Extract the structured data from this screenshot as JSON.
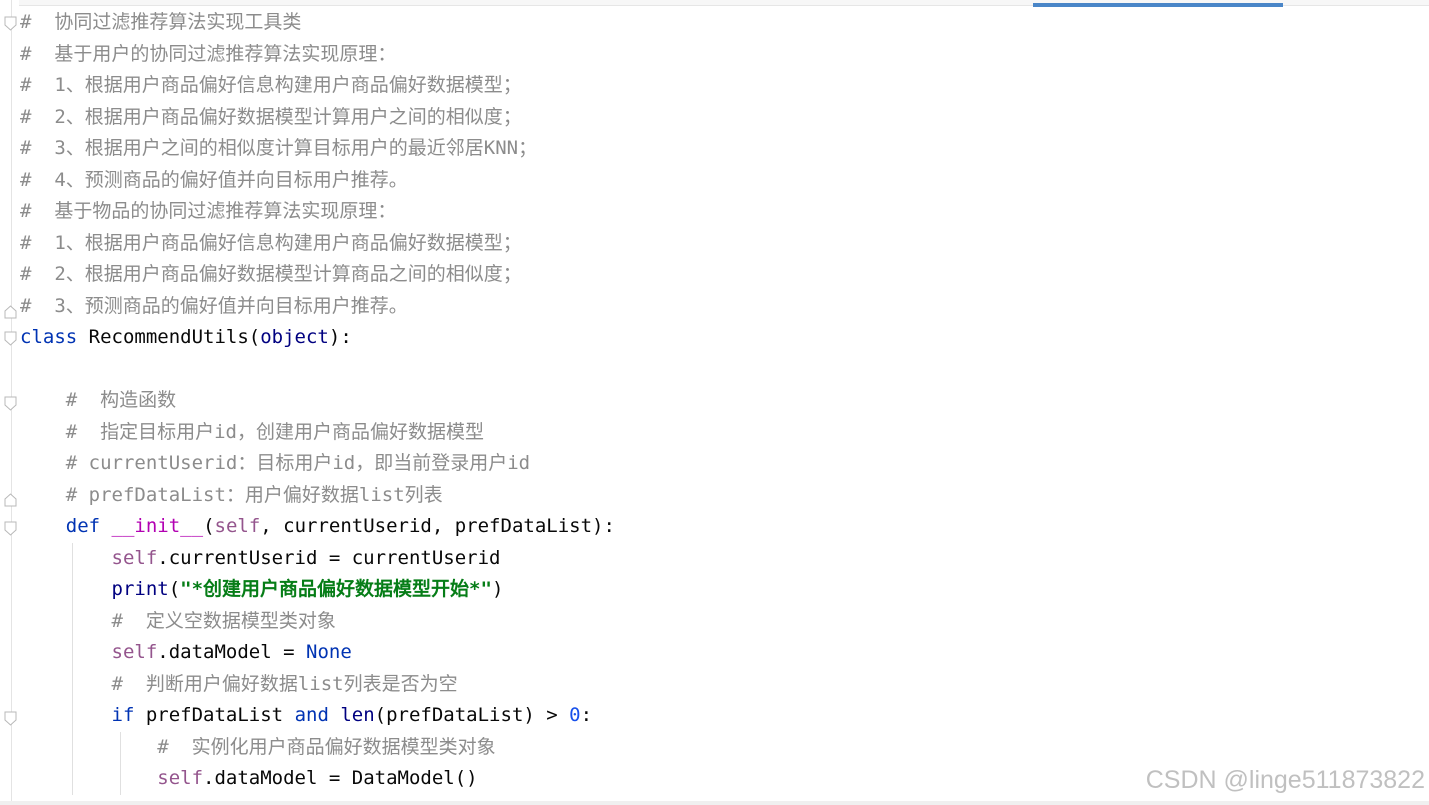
{
  "editor": {
    "lines": [
      {
        "parts": [
          {
            "t": "#  协同过滤推荐算法实现工具类",
            "c": "cm"
          }
        ]
      },
      {
        "parts": [
          {
            "t": "#  基于用户的协同过滤推荐算法实现原理：",
            "c": "cm"
          }
        ]
      },
      {
        "parts": [
          {
            "t": "#  1、根据用户商品偏好信息构建用户商品偏好数据模型；",
            "c": "cm"
          }
        ]
      },
      {
        "parts": [
          {
            "t": "#  2、根据用户商品偏好数据模型计算用户之间的相似度；",
            "c": "cm"
          }
        ]
      },
      {
        "parts": [
          {
            "t": "#  3、根据用户之间的相似度计算目标用户的最近邻居KNN；",
            "c": "cm"
          }
        ]
      },
      {
        "parts": [
          {
            "t": "#  4、预测商品的偏好值并向目标用户推荐。",
            "c": "cm"
          }
        ]
      },
      {
        "parts": [
          {
            "t": "#  基于物品的协同过滤推荐算法实现原理：",
            "c": "cm"
          }
        ]
      },
      {
        "parts": [
          {
            "t": "#  1、根据用户商品偏好信息构建用户商品偏好数据模型；",
            "c": "cm"
          }
        ]
      },
      {
        "parts": [
          {
            "t": "#  2、根据用户商品偏好数据模型计算商品之间的相似度；",
            "c": "cm"
          }
        ]
      },
      {
        "parts": [
          {
            "t": "#  3、预测商品的偏好值并向目标用户推荐。",
            "c": "cm"
          }
        ]
      },
      {
        "parts": [
          {
            "t": "class",
            "c": "kw"
          },
          {
            "t": " RecommendUtils(",
            "c": ""
          },
          {
            "t": "object",
            "c": "bi"
          },
          {
            "t": "):",
            "c": ""
          }
        ]
      },
      {
        "parts": []
      },
      {
        "parts": [
          {
            "t": "    ",
            "c": ""
          },
          {
            "t": "#  构造函数",
            "c": "cm"
          }
        ]
      },
      {
        "parts": [
          {
            "t": "    ",
            "c": ""
          },
          {
            "t": "#  指定目标用户id，创建用户商品偏好数据模型",
            "c": "cm"
          }
        ]
      },
      {
        "parts": [
          {
            "t": "    ",
            "c": ""
          },
          {
            "t": "# currentUserid：目标用户id，即当前登录用户id",
            "c": "cm"
          }
        ]
      },
      {
        "parts": [
          {
            "t": "    ",
            "c": ""
          },
          {
            "t": "# prefDataList：用户偏好数据list列表",
            "c": "cm"
          }
        ]
      },
      {
        "parts": [
          {
            "t": "    ",
            "c": ""
          },
          {
            "t": "def",
            "c": "kw"
          },
          {
            "t": " ",
            "c": ""
          },
          {
            "t": "__init__",
            "c": "mg"
          },
          {
            "t": "(",
            "c": ""
          },
          {
            "t": "self",
            "c": "self"
          },
          {
            "t": ", currentUserid, prefDataList):",
            "c": ""
          }
        ]
      },
      {
        "parts": [
          {
            "t": "        ",
            "c": ""
          },
          {
            "t": "self",
            "c": "self"
          },
          {
            "t": ".currentUserid = currentUserid",
            "c": ""
          }
        ]
      },
      {
        "parts": [
          {
            "t": "        ",
            "c": ""
          },
          {
            "t": "print",
            "c": "bi"
          },
          {
            "t": "(",
            "c": ""
          },
          {
            "t": "\"*创建用户商品偏好数据模型开始*\"",
            "c": "str"
          },
          {
            "t": ")",
            "c": ""
          }
        ]
      },
      {
        "parts": [
          {
            "t": "        ",
            "c": ""
          },
          {
            "t": "#  定义空数据模型类对象",
            "c": "cm"
          }
        ]
      },
      {
        "parts": [
          {
            "t": "        ",
            "c": ""
          },
          {
            "t": "self",
            "c": "self"
          },
          {
            "t": ".dataModel = ",
            "c": ""
          },
          {
            "t": "None",
            "c": "kw"
          }
        ]
      },
      {
        "parts": [
          {
            "t": "        ",
            "c": ""
          },
          {
            "t": "#  判断用户偏好数据list列表是否为空",
            "c": "cm"
          }
        ]
      },
      {
        "parts": [
          {
            "t": "        ",
            "c": ""
          },
          {
            "t": "if",
            "c": "kw"
          },
          {
            "t": " prefDataList ",
            "c": ""
          },
          {
            "t": "and",
            "c": "kw"
          },
          {
            "t": " ",
            "c": ""
          },
          {
            "t": "len",
            "c": "bi"
          },
          {
            "t": "(prefDataList) > ",
            "c": ""
          },
          {
            "t": "0",
            "c": "num"
          },
          {
            "t": ":",
            "c": ""
          }
        ]
      },
      {
        "parts": [
          {
            "t": "            ",
            "c": ""
          },
          {
            "t": "#  实例化用户商品偏好数据模型类对象",
            "c": "cm"
          }
        ]
      },
      {
        "parts": [
          {
            "t": "            ",
            "c": ""
          },
          {
            "t": "self",
            "c": "self"
          },
          {
            "t": ".dataModel = DataModel()",
            "c": ""
          }
        ]
      }
    ]
  },
  "watermark": "CSDN @linge511873822",
  "colors": {
    "comment": "#8c8c8c",
    "keyword": "#0033b3",
    "self": "#94558d",
    "magic": "#b200b2",
    "builtin": "#000080",
    "string": "#067d17",
    "number": "#1750eb",
    "tab_accent": "#4a86c8"
  }
}
